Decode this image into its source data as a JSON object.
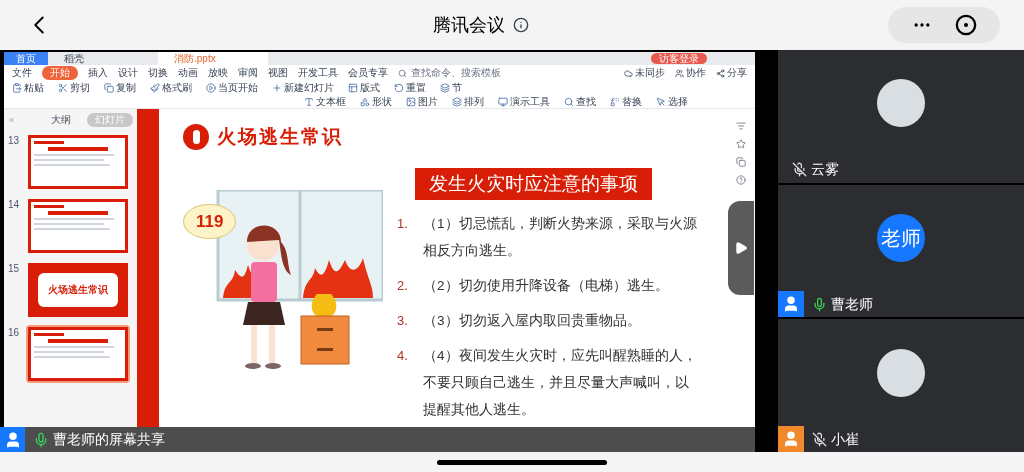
{
  "top_bar": {
    "title": "腾讯会议"
  },
  "wps": {
    "home_tab": "首页",
    "doc_tabs": [
      {
        "label": "稻壳",
        "selected": false
      },
      {
        "label": "消防.pptx",
        "selected": true
      }
    ],
    "login_button": "访客登录",
    "menu": [
      {
        "label": "文件",
        "selected": false
      },
      {
        "label": "开始",
        "selected": true
      },
      {
        "label": "插入",
        "selected": false
      },
      {
        "label": "设计",
        "selected": false
      },
      {
        "label": "切换",
        "selected": false
      },
      {
        "label": "动画",
        "selected": false
      },
      {
        "label": "放映",
        "selected": false
      },
      {
        "label": "审阅",
        "selected": false
      },
      {
        "label": "视图",
        "selected": false
      },
      {
        "label": "开发工具",
        "selected": false
      },
      {
        "label": "会员专享",
        "selected": false
      }
    ],
    "search_placeholder": "查找命令、搜索模板",
    "collab": [
      "未同步",
      "协作",
      "分享"
    ],
    "tools_row1": [
      "粘贴",
      "剪切",
      "复制",
      "格式刷",
      "当页开始",
      "新建幻灯片",
      "版式",
      "重置",
      "节"
    ],
    "tools_row2": [
      "文本框",
      "形状",
      "图片",
      "排列",
      "演示工具",
      "查找",
      "替换",
      "选择"
    ]
  },
  "slide_panel": {
    "tabs": [
      {
        "label": "大纲",
        "selected": false
      },
      {
        "label": "幻灯片",
        "selected": true
      }
    ],
    "thumbnails": [
      {
        "number": "13",
        "kind": "content",
        "selected": false
      },
      {
        "number": "14",
        "kind": "content",
        "selected": false
      },
      {
        "number": "15",
        "kind": "cover",
        "title": "火场逃生常识",
        "selected": false
      },
      {
        "number": "16",
        "kind": "content",
        "selected": true
      }
    ]
  },
  "slide": {
    "title": "火场逃生常识",
    "bubble": "119",
    "heading": "发生火灾时应注意的事项",
    "items": [
      {
        "number": "1.",
        "text": "（1）切忌慌乱，判断火势来源，采取与火源相反方向逃生。"
      },
      {
        "number": "2.",
        "text": "（2）切勿使用升降设备（电梯）逃生。"
      },
      {
        "number": "3.",
        "text": "（3）切勿返入屋内取回贵重物品。"
      },
      {
        "number": "4.",
        "text": "（4）夜间发生火灾时，应先叫醒熟睡的人，不要只顾自己逃生，并且尽量大声喊叫，以提醒其他人逃生。"
      }
    ]
  },
  "share_bar": {
    "label": "曹老师的屏幕共享"
  },
  "participants": [
    {
      "name": "云雾",
      "muted": true,
      "kind": "photo"
    },
    {
      "name": "曹老师",
      "muted": false,
      "kind": "initials",
      "avatar_text": "老师",
      "color": "#1677ff"
    },
    {
      "name": "小崔",
      "muted": true,
      "kind": "photo",
      "color": "#f0892b"
    }
  ]
}
